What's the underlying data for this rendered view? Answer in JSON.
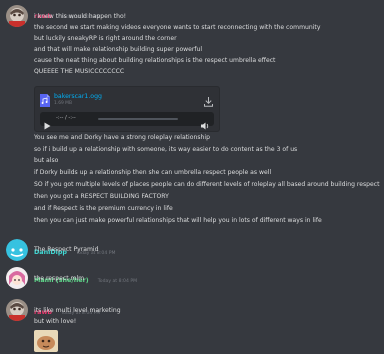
{
  "colors": {
    "background": "#36393f",
    "rawb": "#e8386d",
    "danidipp": "#3fd9d4",
    "mami": "#5fd68a",
    "link": "#00aff4"
  },
  "messages": [
    {
      "author": "rawb",
      "timestamp": "Today at 8:02 PM",
      "lines": [
        "i knew this would happen tho!",
        "the second we start making videos everyone wants to start reconnecting with the community",
        "but luckily sneakyRP is right around the corner",
        "and that will make relationship building super powerful",
        "cause the neat thing about building relationships is the respect umbrella effect",
        "QUEEEE THE MUSICCCCCCCC"
      ],
      "attachment": {
        "file_name": "bakerscar1.ogg",
        "file_size": "1.69 MB",
        "time": "-:-- / -:--",
        "icon": "file-audio-icon",
        "download_icon": "download-icon"
      },
      "after_lines": [
        "You see me and Dorky have a strong roleplay relationship",
        "so if i build up a relationship with someone, its way easier to do content as the 3 of us",
        "but also",
        "if Dorky builds up a relationship then she can umbrella respect people as well",
        "SO if you got multiple levels of places people can do different levels of roleplay all based around building respect",
        "then you got a RESPECT BUILDING FACTORY",
        "and if Respect is the premium currency in life",
        "then you can just make powerful relationships that will help you in lots of different ways in life"
      ]
    },
    {
      "author": "DaniDipp",
      "timestamp": "Today at 8:04 PM",
      "lines": [
        "The Respect Pyramid"
      ]
    },
    {
      "author": "Mami (she/her)",
      "timestamp": "Today at 8:04 PM",
      "lines": [
        "the respect mlm"
      ]
    },
    {
      "author": "rawb",
      "timestamp": "Today at 8:04 PM",
      "lines": [
        "its like multi level marketing",
        "but with love!"
      ]
    }
  ]
}
